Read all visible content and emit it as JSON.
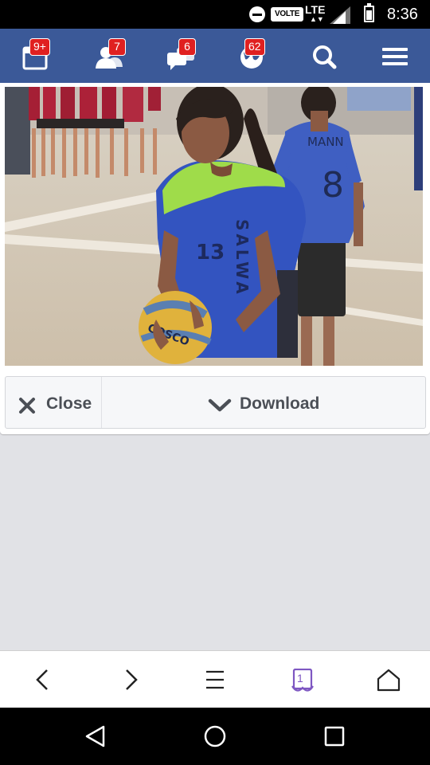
{
  "status_bar": {
    "volte": "VOLTE",
    "network": "LTE",
    "time": "8:36"
  },
  "topbar": {
    "notifications_badge": "9+",
    "friend_requests_badge": "7",
    "messages_badge": "6",
    "globe_badge": "62"
  },
  "photo": {
    "jersey_front_number": "13",
    "jersey_side_text": "SALWA",
    "jersey_back_text": "MANN",
    "jersey_back_number": "8",
    "ball_text": "COSCO"
  },
  "actions": {
    "close_label": "Close",
    "download_label": "Download"
  },
  "browser_bar": {
    "tab_count": "1"
  },
  "colors": {
    "facebook_blue": "#3b5998",
    "badge_red": "#e02020",
    "browser_accent": "#7e57c2"
  },
  "icons": {
    "topbar": [
      "calendar-icon",
      "friends-icon",
      "messages-icon",
      "globe-icon",
      "search-icon",
      "menu-icon"
    ],
    "browser": [
      "back-icon",
      "forward-icon",
      "menu-lines-icon",
      "tabs-icon",
      "home-icon"
    ],
    "nav": [
      "nav-back-icon",
      "nav-home-icon",
      "nav-recents-icon"
    ]
  }
}
